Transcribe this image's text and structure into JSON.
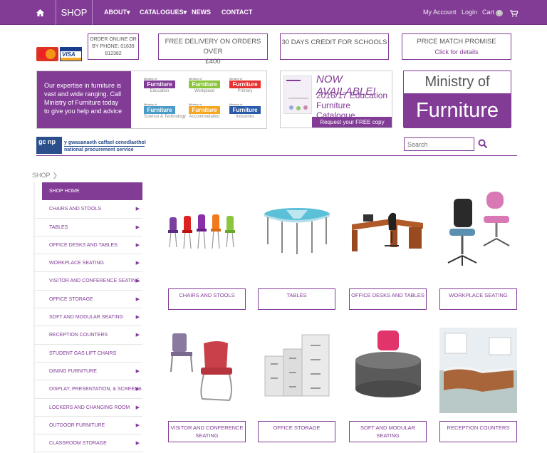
{
  "nav": {
    "shop": "SHOP",
    "links": [
      "ABOUT▾",
      "CATALOGUES▾",
      "NEWS",
      "CONTACT"
    ],
    "my_account": "My Account",
    "login": "Login",
    "cart": "Cart",
    "cart_count": "0"
  },
  "promo": {
    "order_line1": "ORDER ONLINE OR",
    "order_line2": "BY PHONE: 01639",
    "order_line3": "812382",
    "delivery_line1": "FREE DELIVERY ON ORDERS OVER",
    "delivery_line2": "£400",
    "credit": "30 DAYS CREDIT FOR SCHOOLS",
    "price_match": "PRICE MATCH PROMISE",
    "price_match_sub": "Click for details"
  },
  "cards": {
    "mastercard": "MasterCard",
    "visa": "VISA"
  },
  "expertise": {
    "text": "Our expertise in furniture is vast and wide ranging. Call Ministry of Furniture today to give you help and advice",
    "brands": [
      {
        "label": "Ministry of",
        "word": "Furniture",
        "sub": "Education",
        "color": "#823c96"
      },
      {
        "label": "Ministry of",
        "word": "Furniture",
        "sub": "Workplace",
        "color": "#8cc63f"
      },
      {
        "label": "Ministry of",
        "word": "Furniture",
        "sub": "Primary",
        "color": "#e63232"
      },
      {
        "label": "Ministry of",
        "word": "Furniture",
        "sub": "Science & Technology",
        "color": "#4a9bc6"
      },
      {
        "label": "Ministry of",
        "word": "Furniture",
        "sub": "Accommodation",
        "color": "#f5a623"
      },
      {
        "label": "Ministry of",
        "word": "Furniture",
        "sub": "Industries",
        "color": "#2b5aa8"
      }
    ]
  },
  "catalogue": {
    "now": "NOW AVAILABLE!",
    "title": "2016/17 Education Furniture Catalogue",
    "request": "Request your FREE copy today!"
  },
  "ministry": {
    "top": "Ministry of",
    "bottom": "Furniture"
  },
  "nps": {
    "logo": "gc np",
    "welsh": "y gwasanaeth caffael cenedlaethol",
    "english": "national procurement service"
  },
  "search": {
    "placeholder": "Search"
  },
  "breadcrumb": {
    "shop": "SHOP"
  },
  "sidebar": [
    {
      "label": "SHOP HOME",
      "active": true,
      "arrow": false
    },
    {
      "label": "CHAIRS AND STOOLS",
      "arrow": true
    },
    {
      "label": "TABLES",
      "arrow": true
    },
    {
      "label": "OFFICE DESKS AND TABLES",
      "arrow": true
    },
    {
      "label": "WORKPLACE SEATING",
      "arrow": true
    },
    {
      "label": "VISITOR AND CONFERENCE SEATING",
      "arrow": true
    },
    {
      "label": "OFFICE STORAGE",
      "arrow": true
    },
    {
      "label": "SOFT AND MODULAR SEATING",
      "arrow": true
    },
    {
      "label": "RECEPTION COUNTERS",
      "arrow": true
    },
    {
      "label": "STUDENT GAS LIFT CHAIRS",
      "arrow": false
    },
    {
      "label": "DINING FURNITURE",
      "arrow": true
    },
    {
      "label": "DISPLAY, PRESENTATION, & SCREENS",
      "arrow": true
    },
    {
      "label": "LOCKERS AND CHANGING ROOM",
      "arrow": true
    },
    {
      "label": "OUTDOOR FURNITURE",
      "arrow": true
    },
    {
      "label": "CLASSROOM STORAGE",
      "arrow": true
    }
  ],
  "products": [
    {
      "label": "CHAIRS AND STOOLS"
    },
    {
      "label": "TABLES"
    },
    {
      "label": "OFFICE DESKS AND TABLES"
    },
    {
      "label": "WORKPLACE SEATING"
    },
    {
      "label": "VISITOR AND CONFERENCE SEATING"
    },
    {
      "label": "OFFICE STORAGE"
    },
    {
      "label": "SOFT AND MODULAR SEATING"
    },
    {
      "label": "RECEPTION COUNTERS"
    }
  ],
  "colors": {
    "brand": "#823c96"
  }
}
